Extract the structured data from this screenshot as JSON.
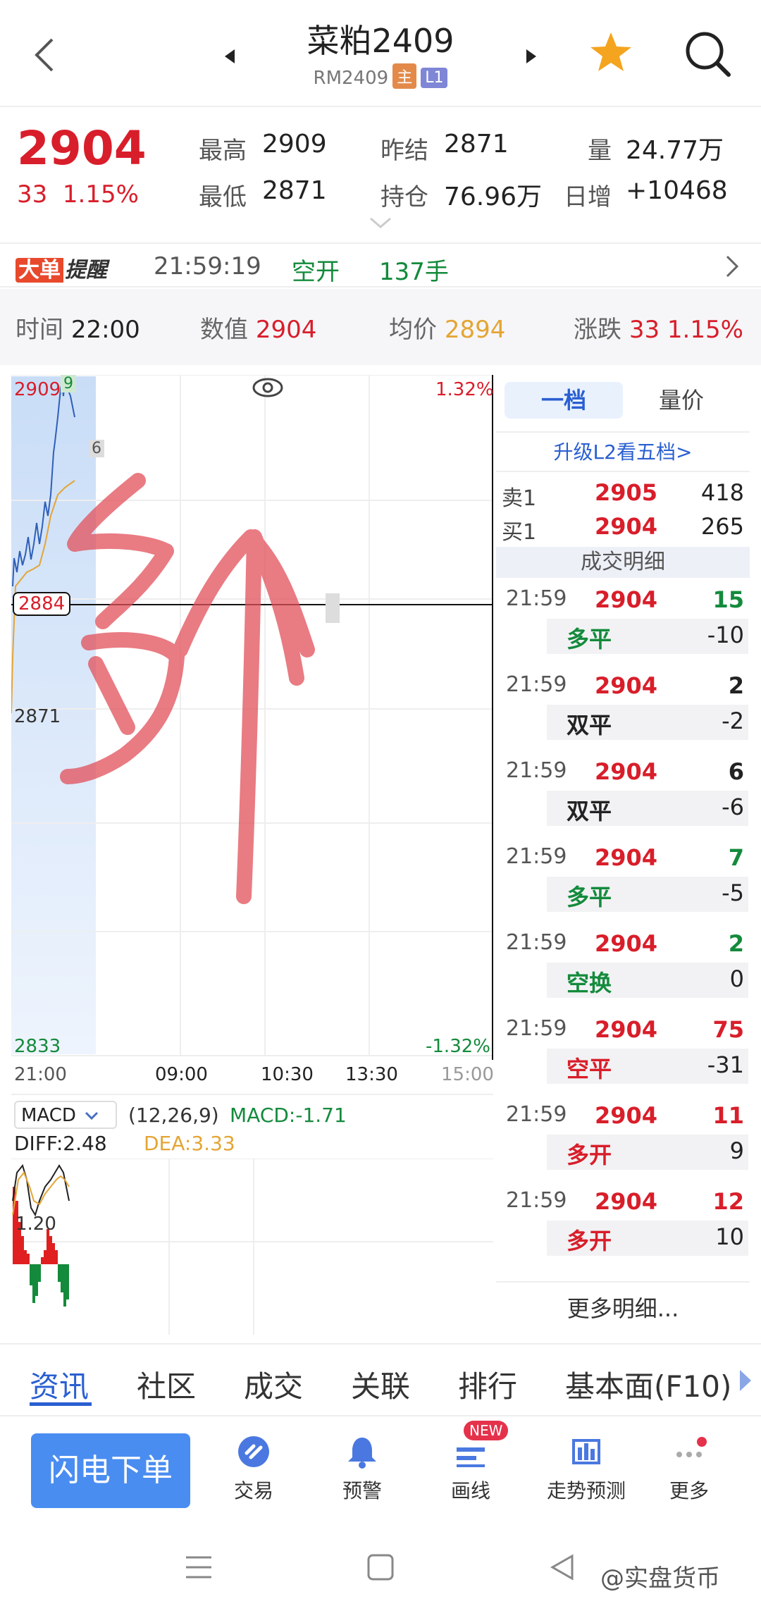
{
  "header": {
    "title": "菜粕2409",
    "code": "RM2409",
    "chip_main": "主",
    "chip_level": "L1"
  },
  "quote": {
    "price": "2904",
    "change": "33",
    "change_pct": "1.15%",
    "high_label": "最高",
    "high": "2909",
    "low_label": "最低",
    "low": "2871",
    "prev_settle_label": "昨结",
    "prev_settle": "2871",
    "open_interest_label": "持仓",
    "open_interest": "76.96万",
    "volume_label": "量",
    "volume": "24.77万",
    "daily_inc_label": "日增",
    "daily_inc": "+10468"
  },
  "alert": {
    "badge_part1": "大单",
    "badge_part2": "提醒",
    "time": "21:59:19",
    "action": "空开",
    "lots": "137手"
  },
  "info_bar": {
    "time_label": "时间",
    "time": "22:00",
    "value_label": "数值",
    "value": "2904",
    "avg_label": "均价",
    "avg": "2894",
    "change_label": "涨跌",
    "change": "33",
    "change_pct": "1.15%"
  },
  "chart": {
    "top_price": "2909",
    "top_tag": "9",
    "mid_tag": "6",
    "top_pct": "1.32%",
    "crosshair_price": "2884",
    "mid_price": "2871",
    "bottom_price": "2833",
    "bottom_pct": "-1.32%",
    "x_ticks": [
      "21:00",
      "09:00",
      "10:30",
      "13:30",
      "15:00"
    ],
    "indicator": "MACD",
    "params": "(12,26,9)",
    "macd": "MACD:-1.71",
    "diff": "DIFF:2.48",
    "dea": "DEA:3.33",
    "macd_tick": "1.20"
  },
  "panel": {
    "tab1": "一档",
    "tab2": "量价",
    "upgrade": "升级L2看五档>",
    "ask_label": "卖1",
    "ask_price": "2905",
    "ask_vol": "418",
    "bid_label": "买1",
    "bid_price": "2904",
    "bid_vol": "265",
    "trades_title": "成交明细",
    "more": "更多明细...",
    "trades": [
      {
        "time": "21:59",
        "price": "2904",
        "vol": "15",
        "type": "多平",
        "oi": "-10"
      },
      {
        "time": "21:59",
        "price": "2904",
        "vol": "2",
        "type": "双平",
        "oi": "-2"
      },
      {
        "time": "21:59",
        "price": "2904",
        "vol": "6",
        "type": "双平",
        "oi": "-6"
      },
      {
        "time": "21:59",
        "price": "2904",
        "vol": "7",
        "type": "多平",
        "oi": "-5"
      },
      {
        "time": "21:59",
        "price": "2904",
        "vol": "2",
        "type": "空换",
        "oi": "0"
      },
      {
        "time": "21:59",
        "price": "2904",
        "vol": "75",
        "type": "空平",
        "oi": "-31"
      },
      {
        "time": "21:59",
        "price": "2904",
        "vol": "11",
        "type": "多开",
        "oi": "9"
      },
      {
        "time": "21:59",
        "price": "2904",
        "vol": "12",
        "type": "多开",
        "oi": "10"
      }
    ]
  },
  "bottom_tabs": [
    "资讯",
    "社区",
    "成交",
    "关联",
    "排行",
    "基本面(F10)"
  ],
  "toolbar": {
    "flash_order": "闪电下单",
    "trade": "交易",
    "alert": "预警",
    "draw": "画线",
    "draw_badge": "NEW",
    "forecast": "走势预测",
    "more": "更多"
  },
  "watermark": "@实盘货币",
  "colors": {
    "up": "#d81e2a",
    "down": "#148a3c",
    "avg_line": "#e4a535",
    "accent": "#4a8df1"
  }
}
